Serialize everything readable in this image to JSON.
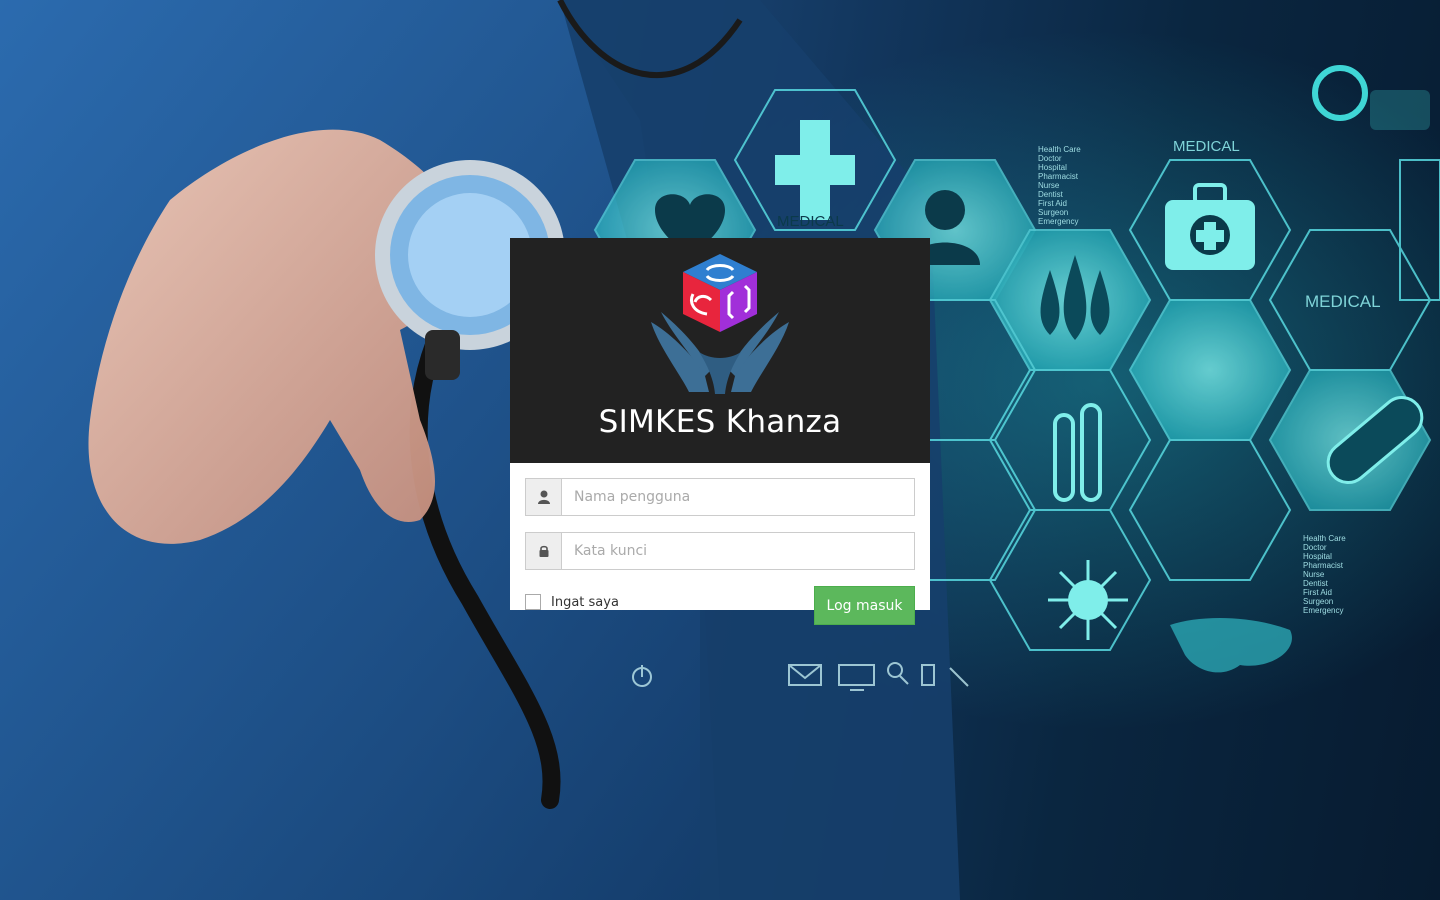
{
  "app": {
    "title": "SIMKES Khanza"
  },
  "login_form": {
    "username_placeholder": "Nama pengguna",
    "username_value": "",
    "password_placeholder": "Kata kunci",
    "password_value": "",
    "remember_label": "Ingat saya",
    "remember_checked": false,
    "submit_label": "Log masuk"
  },
  "background": {
    "labels": [
      "MEDICAL",
      "MEDICAL",
      "MEDICAL"
    ],
    "list_1": [
      "Health Care",
      "Doctor",
      "Hospital",
      "Pharmacist",
      "Nurse",
      "Dentist",
      "First Aid",
      "Surgeon",
      "Emergency"
    ],
    "list_2": [
      "Health Care",
      "Doctor",
      "Hospital",
      "Pharmacist",
      "Nurse",
      "Dentist",
      "First Aid",
      "Surgeon",
      "Emergency"
    ]
  },
  "icons": {
    "user": "user-icon",
    "lock": "lock-icon",
    "logo": "khanza-logo"
  },
  "colors": {
    "header_bg": "#222222",
    "button_bg": "#5cb85c",
    "accent_cyan": "#3fd6d6"
  }
}
